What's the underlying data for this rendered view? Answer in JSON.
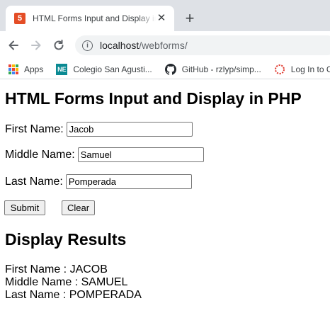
{
  "browser": {
    "tab": {
      "title": "HTML Forms Input and Display in PHP",
      "favicon": "html5-icon"
    },
    "address": {
      "host": "localhost",
      "path": "/webforms/"
    },
    "bookmarks": [
      {
        "label": "Apps",
        "icon": "apps-grid-icon"
      },
      {
        "label": "Colegio San Agusti...",
        "icon": "ne-icon",
        "badge": "NE"
      },
      {
        "label": "GitHub - rzlyp/simp...",
        "icon": "github-icon"
      },
      {
        "label": "Log In to C",
        "icon": "login-icon"
      }
    ]
  },
  "page": {
    "title": "HTML Forms Input and Display in PHP",
    "form": {
      "first_name": {
        "label": "First Name:",
        "value": "Jacob"
      },
      "middle_name": {
        "label": "Middle Name:",
        "value": "Samuel"
      },
      "last_name": {
        "label": "Last Name:",
        "value": "Pomperada"
      },
      "submit_label": "Submit",
      "clear_label": "Clear"
    },
    "results": {
      "title": "Display Results",
      "lines": [
        "First Name : JACOB",
        "Middle Name : SAMUEL",
        "Last Name : POMPERADA"
      ]
    }
  },
  "colors": {
    "tabstrip": "#dee1e6",
    "omnibox": "#f1f3f4",
    "favicon": "#e44d26",
    "button_bg": "#efefef"
  }
}
